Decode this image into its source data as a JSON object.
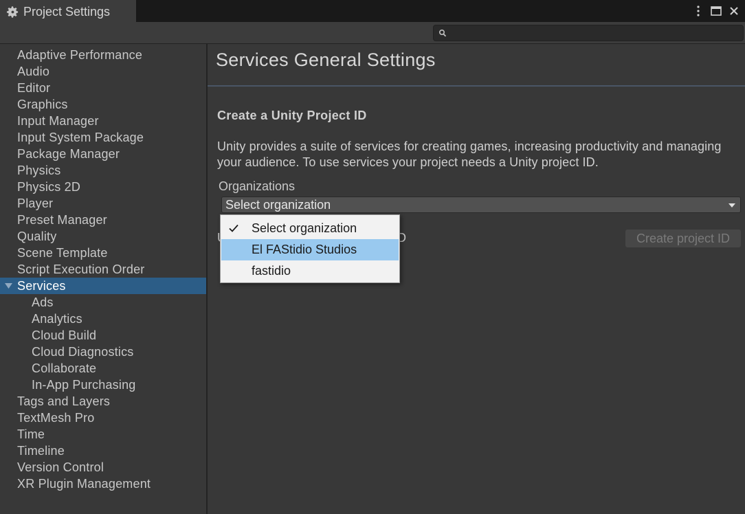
{
  "window": {
    "tab_title": "Project Settings",
    "tab_icon": "gear-icon",
    "controls": [
      "kebab-menu-icon",
      "maximize-icon",
      "close-icon"
    ]
  },
  "search": {
    "placeholder": "",
    "icon": "search-icon"
  },
  "sidebar": {
    "items": [
      {
        "label": "Adaptive Performance",
        "level": 0
      },
      {
        "label": "Audio",
        "level": 0
      },
      {
        "label": "Editor",
        "level": 0
      },
      {
        "label": "Graphics",
        "level": 0
      },
      {
        "label": "Input Manager",
        "level": 0
      },
      {
        "label": "Input System Package",
        "level": 0
      },
      {
        "label": "Package Manager",
        "level": 0
      },
      {
        "label": "Physics",
        "level": 0
      },
      {
        "label": "Physics 2D",
        "level": 0
      },
      {
        "label": "Player",
        "level": 0
      },
      {
        "label": "Preset Manager",
        "level": 0
      },
      {
        "label": "Quality",
        "level": 0
      },
      {
        "label": "Scene Template",
        "level": 0
      },
      {
        "label": "Script Execution Order",
        "level": 0
      },
      {
        "label": "Services",
        "level": 0,
        "selected": true,
        "expanded": true
      },
      {
        "label": "Ads",
        "level": 1
      },
      {
        "label": "Analytics",
        "level": 1
      },
      {
        "label": "Cloud Build",
        "level": 1
      },
      {
        "label": "Cloud Diagnostics",
        "level": 1
      },
      {
        "label": "Collaborate",
        "level": 1
      },
      {
        "label": "In-App Purchasing",
        "level": 1
      },
      {
        "label": "Tags and Layers",
        "level": 0
      },
      {
        "label": "TextMesh Pro",
        "level": 0
      },
      {
        "label": "Time",
        "level": 0
      },
      {
        "label": "Timeline",
        "level": 0
      },
      {
        "label": "Version Control",
        "level": 0
      },
      {
        "label": "XR Plugin Management",
        "level": 0
      }
    ]
  },
  "main": {
    "title": "Services General Settings",
    "section_title": "Create a Unity Project ID",
    "description": "Unity provides a suite of services for creating games, increasing productivity and managing your audience. To use services your project needs a Unity project ID.",
    "organizations_label": "Organizations",
    "select_value": "Select organization",
    "obscured_left": "U",
    "obscured_right": "D",
    "create_button": "Create project ID"
  },
  "dropdown": {
    "options": [
      {
        "label": "Select organization",
        "checked": true
      },
      {
        "label": "El FAStidio Studios",
        "highlighted": true
      },
      {
        "label": "fastidio"
      }
    ]
  },
  "colors": {
    "selection": "#2c5d87",
    "highlight": "#99c9ef",
    "background": "#383838"
  }
}
